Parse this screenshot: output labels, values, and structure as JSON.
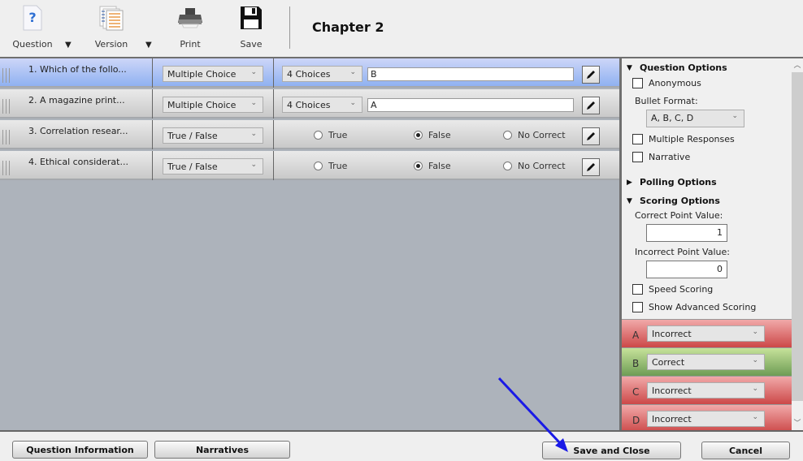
{
  "toolbar": {
    "question_label": "Question",
    "version_label": "Version",
    "print_label": "Print",
    "save_label": "Save",
    "title": "Chapter 2"
  },
  "questions": [
    {
      "title": "1. Which of the follo...",
      "type": "Multiple Choice",
      "choices": "4 Choices",
      "answer": "B",
      "selected": true
    },
    {
      "title": "2. A magazine print...",
      "type": "Multiple Choice",
      "choices": "4 Choices",
      "answer": "A",
      "selected": false
    },
    {
      "title": "3. Correlation resear...",
      "type": "True / False",
      "options": [
        "True",
        "False",
        "No Correct"
      ],
      "checked": "False"
    },
    {
      "title": "4. Ethical considerat...",
      "type": "True / False",
      "options": [
        "True",
        "False",
        "No Correct"
      ],
      "checked": "False"
    }
  ],
  "side": {
    "question_options": "Question Options",
    "anonymous": "Anonymous",
    "bullet_format_label": "Bullet Format:",
    "bullet_format_value": "A, B, C, D",
    "multiple_responses": "Multiple Responses",
    "narrative": "Narrative",
    "polling_options": "Polling Options",
    "scoring_options": "Scoring Options",
    "correct_point_label": "Correct Point Value:",
    "correct_point_value": "1",
    "incorrect_point_label": "Incorrect Point Value:",
    "incorrect_point_value": "0",
    "speed_scoring": "Speed Scoring",
    "show_advanced_scoring": "Show Advanced Scoring",
    "answers": [
      {
        "letter": "A",
        "value": "Incorrect"
      },
      {
        "letter": "B",
        "value": "Correct"
      },
      {
        "letter": "C",
        "value": "Incorrect"
      },
      {
        "letter": "D",
        "value": "Incorrect"
      }
    ]
  },
  "footer": {
    "question_information": "Question Information",
    "narratives": "Narratives",
    "save_and_close": "Save and Close",
    "cancel": "Cancel"
  },
  "colors": {
    "selected_row": "#8fb1f1",
    "incorrect": "#cc4848",
    "correct": "#6e9c55",
    "annotation_arrow": "#1a1ae6"
  }
}
